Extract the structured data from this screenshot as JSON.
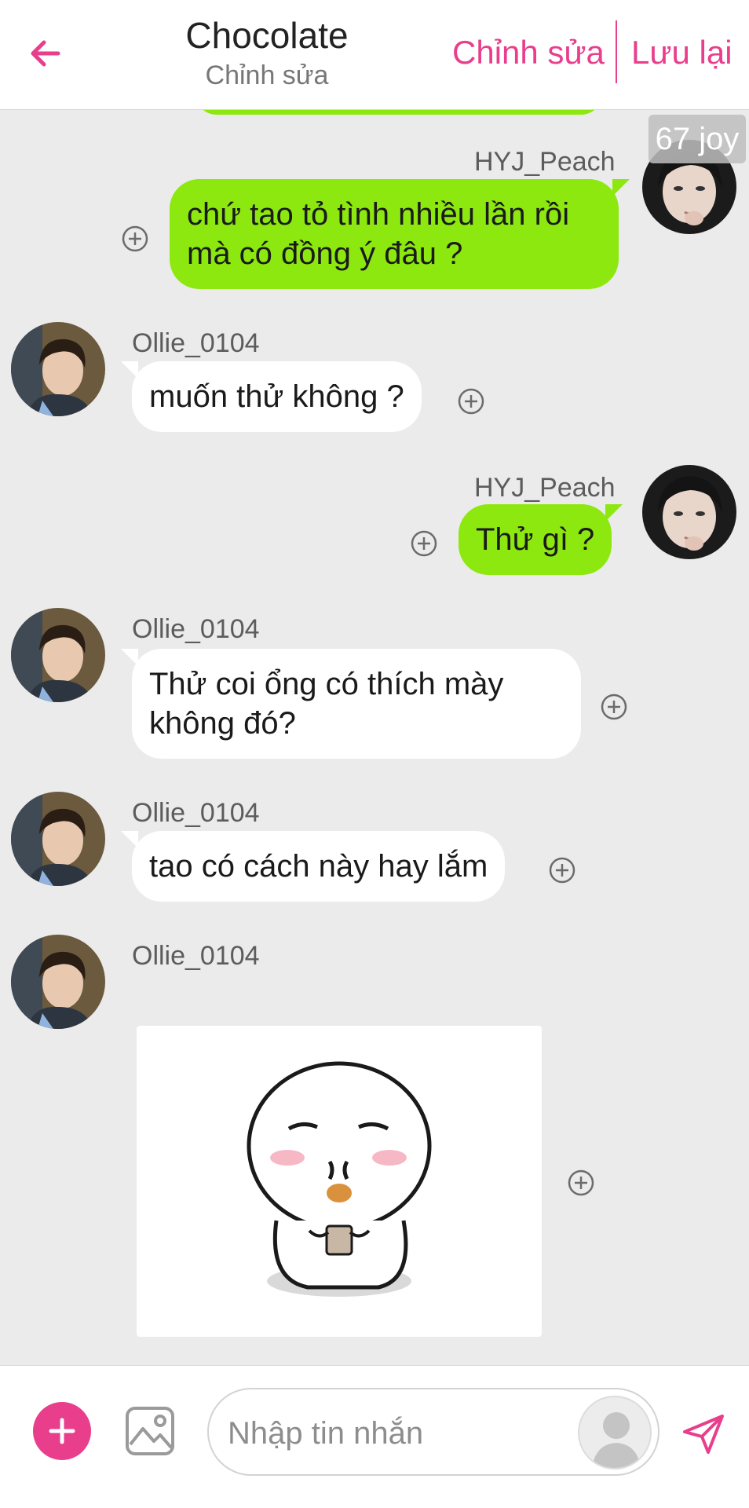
{
  "header": {
    "title": "Chocolate",
    "subtitle": "Chỉnh sửa",
    "edit_label": "Chỉnh sửa",
    "save_label": "Lưu lại",
    "back_icon": "arrow-left-icon"
  },
  "counter": "67 joy",
  "messages": [
    {
      "sender": "HYJ_Peach",
      "side": "right",
      "lines": [
        "chứ tao tỏ tình nhiều lần rồi",
        "mà có đồng ý đâu ?"
      ]
    },
    {
      "sender": "Ollie_0104",
      "side": "left",
      "lines": [
        "muốn thử không ?"
      ]
    },
    {
      "sender": "HYJ_Peach",
      "side": "right",
      "lines": [
        "Thử gì ?"
      ]
    },
    {
      "sender": "Ollie_0104",
      "side": "left",
      "lines": [
        "Thử coi ổng có thích mày",
        "không đó?"
      ]
    },
    {
      "sender": "Ollie_0104",
      "side": "left",
      "lines": [
        "tao có cách này hay lắm"
      ]
    },
    {
      "sender": "Ollie_0104",
      "side": "left",
      "type": "sticker",
      "lines": []
    }
  ],
  "composer": {
    "placeholder": "Nhập tin nhắn"
  },
  "colors": {
    "accent": "#e83e8c",
    "outgoing_bubble": "#8de80f",
    "incoming_bubble": "#ffffff",
    "background": "#ebebeb"
  }
}
